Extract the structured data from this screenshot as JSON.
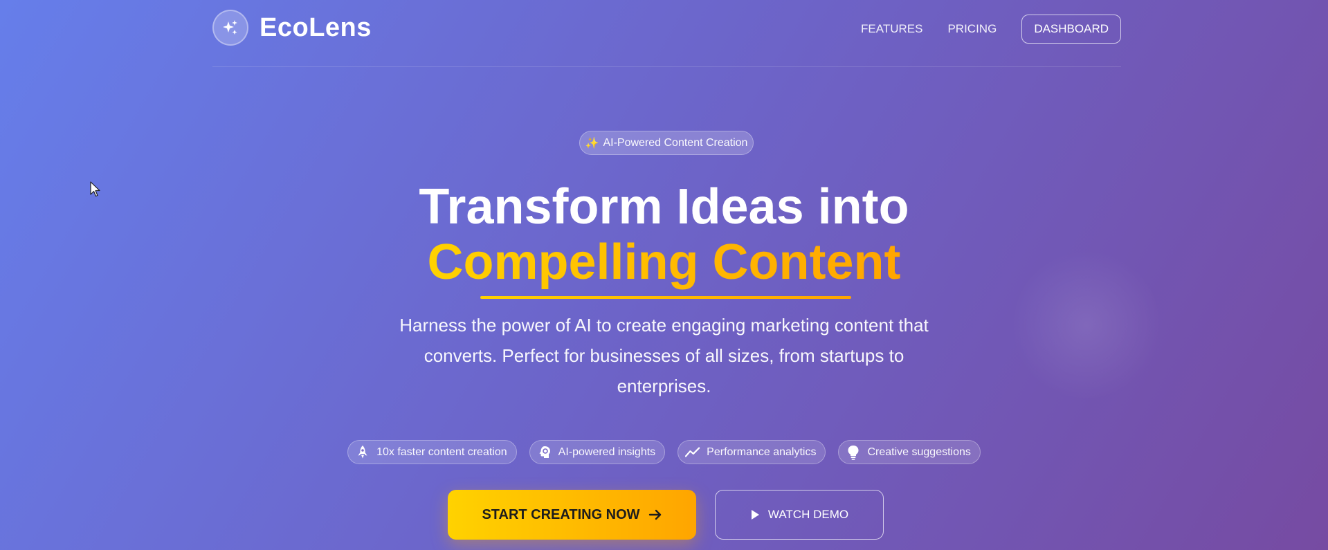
{
  "brand": {
    "name": "EcoLens",
    "logo_icon": "sparkles-icon"
  },
  "nav": {
    "features": "FEATURES",
    "pricing": "PRICING",
    "dashboard": "DASHBOARD"
  },
  "hero": {
    "badge_icon": "✨",
    "badge_text": "AI-Powered Content Creation",
    "title_line1": "Transform Ideas into",
    "title_line2": "Compelling Content",
    "subtitle": "Harness the power of AI to create engaging marketing content that converts. Perfect for businesses of all sizes, from startups to enterprises."
  },
  "features": [
    {
      "icon": "rocket-icon",
      "label": "10x faster content creation"
    },
    {
      "icon": "brain-icon",
      "label": "AI-powered insights"
    },
    {
      "icon": "trend-icon",
      "label": "Performance analytics"
    },
    {
      "icon": "lightbulb-icon",
      "label": "Creative suggestions"
    }
  ],
  "cta": {
    "primary_label": "START CREATING NOW",
    "secondary_label": "WATCH DEMO"
  },
  "colors": {
    "gradient_start": "#667eea",
    "gradient_end": "#764ba2",
    "accent_start": "#ffd200",
    "accent_end": "#ffa500"
  }
}
